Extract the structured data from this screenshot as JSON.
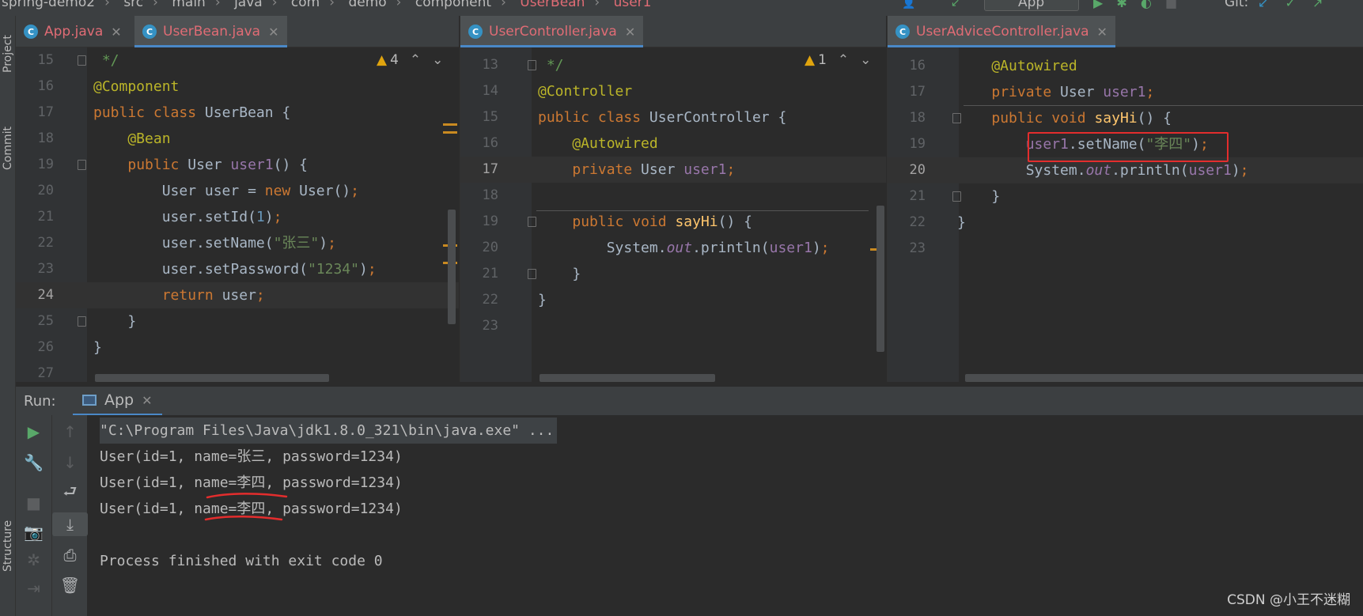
{
  "breadcrumb": {
    "items": [
      "spring-demo2",
      "src",
      "main",
      "java",
      "com",
      "demo",
      "component",
      "UserBean",
      "user1"
    ]
  },
  "toolbar": {
    "run_config": "App",
    "git_label": "Git:"
  },
  "left_tabs": {
    "project": "Project",
    "commit": "Commit",
    "structure": "Structure"
  },
  "editors": [
    {
      "tab": {
        "label": "App.java"
      },
      "tab_active": {
        "label": "UserBean.java"
      },
      "warnings": "4",
      "lines": [
        {
          "n": "15",
          "text": " */"
        },
        {
          "n": "16",
          "text": "@Component"
        },
        {
          "n": "17",
          "text": "public class UserBean {"
        },
        {
          "n": "18",
          "text": "    @Bean"
        },
        {
          "n": "19",
          "text": "    public User user1() {"
        },
        {
          "n": "20",
          "text": "        User user = new User();"
        },
        {
          "n": "21",
          "text": "        user.setId(1);"
        },
        {
          "n": "22",
          "text": "        user.setName(\"张三\");"
        },
        {
          "n": "23",
          "text": "        user.setPassword(\"1234\");"
        },
        {
          "n": "24",
          "text": "        return user;"
        },
        {
          "n": "25",
          "text": "    }"
        },
        {
          "n": "26",
          "text": "}"
        },
        {
          "n": "27",
          "text": ""
        }
      ]
    },
    {
      "tab_active": {
        "label": "UserController.java"
      },
      "warnings": "1",
      "lines": [
        {
          "n": "13",
          "text": " */"
        },
        {
          "n": "14",
          "text": "@Controller"
        },
        {
          "n": "15",
          "text": "public class UserController {"
        },
        {
          "n": "16",
          "text": "    @Autowired"
        },
        {
          "n": "17",
          "text": "    private User user1;"
        },
        {
          "n": "18",
          "text": ""
        },
        {
          "n": "19",
          "text": "    public void sayHi() {"
        },
        {
          "n": "20",
          "text": "        System.out.println(user1);"
        },
        {
          "n": "21",
          "text": "    }"
        },
        {
          "n": "22",
          "text": "}"
        },
        {
          "n": "23",
          "text": ""
        }
      ]
    },
    {
      "tab_active": {
        "label": "UserAdviceController.java"
      },
      "lines": [
        {
          "n": "16",
          "text": "    @Autowired"
        },
        {
          "n": "17",
          "text": "    private User user1;"
        },
        {
          "n": "18",
          "text": "    public void sayHi() {"
        },
        {
          "n": "19",
          "text": "        user1.setName(\"李四\");"
        },
        {
          "n": "20",
          "text": "        System.out.println(user1);"
        },
        {
          "n": "21",
          "text": "    }"
        },
        {
          "n": "22",
          "text": "}"
        },
        {
          "n": "23",
          "text": ""
        }
      ]
    }
  ],
  "run": {
    "label": "Run:",
    "tab_label": "App",
    "output": [
      "\"C:\\Program Files\\Java\\jdk1.8.0_321\\bin\\java.exe\" ...",
      "User(id=1, name=张三, password=1234)",
      "User(id=1, name=李四, password=1234)",
      "User(id=1, name=李四, password=1234)",
      "",
      "Process finished with exit code 0"
    ]
  },
  "watermark": "CSDN @小王不迷糊",
  "colors": {
    "keyword": "#cc7832",
    "annotation": "#bbb529",
    "string": "#6a8759",
    "number": "#6897bb",
    "field": "#9876aa",
    "highlight_box": "#e32d2d"
  }
}
